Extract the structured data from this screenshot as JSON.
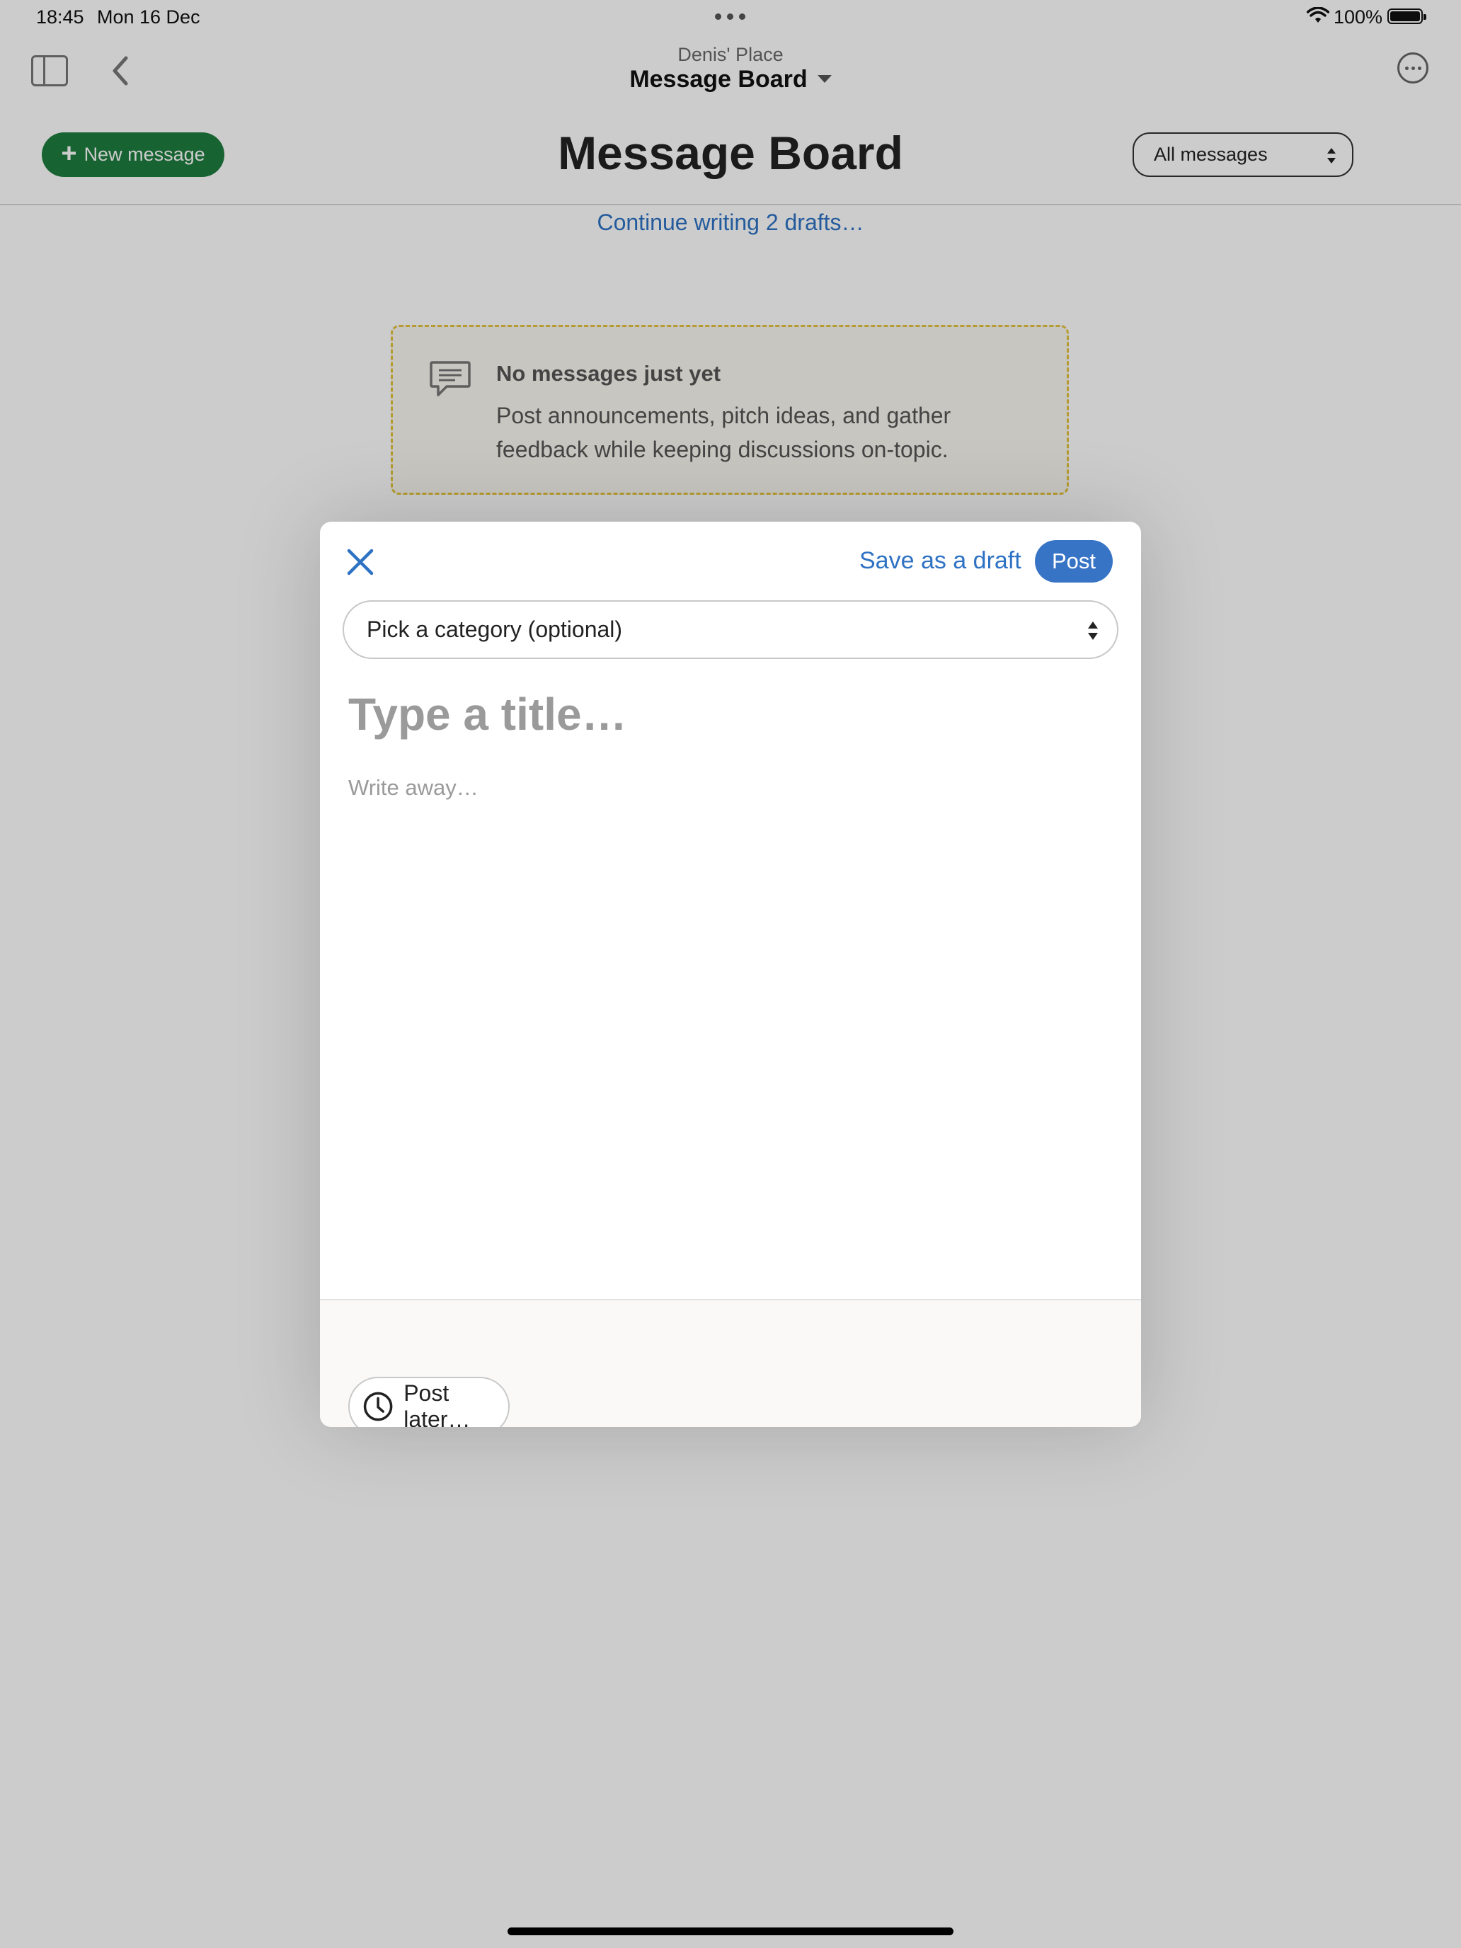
{
  "status_bar": {
    "time": "18:45",
    "date": "Mon 16 Dec",
    "battery": "100%"
  },
  "nav": {
    "breadcrumb": "Denis' Place",
    "title": "Message Board"
  },
  "header": {
    "new_message_label": "New message",
    "page_title": "Message Board",
    "filter_value": "All messages"
  },
  "drafts_link": "Continue writing 2 drafts…",
  "empty_state": {
    "heading": "No messages just yet",
    "body": "Post announcements, pitch ideas, and gather feedback while keeping discussions on-topic."
  },
  "composer": {
    "save_draft_label": "Save as a draft",
    "post_label": "Post",
    "category_value": "Pick a category (optional)",
    "title_placeholder": "Type a title…",
    "body_placeholder": "Write away…",
    "post_later_label": "Post later…"
  },
  "colors": {
    "accent_green": "#1e7c3f",
    "link_blue": "#2e72c4",
    "post_blue": "#3874c6",
    "empty_border": "#e3c23c"
  },
  "icons": [
    "wifi-icon",
    "battery-icon",
    "sidebar-toggle-icon",
    "back-chevron-icon",
    "more-icon",
    "plus-icon",
    "updown-arrows-icon",
    "chat-bubble-icon",
    "close-icon",
    "clock-icon"
  ]
}
